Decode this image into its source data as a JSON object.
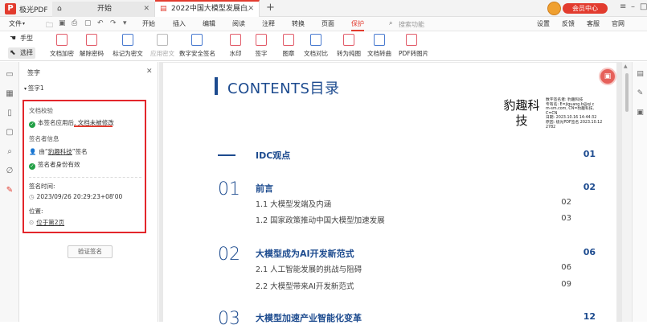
{
  "app": {
    "name": "极光PDF"
  },
  "tabs": [
    {
      "label": "开始"
    },
    {
      "label": "2022中国大模型发展白皮书..."
    }
  ],
  "vip": {
    "label": "会员中心"
  },
  "menu": [
    "文件",
    "开始",
    "插入",
    "编辑",
    "阅读",
    "注释",
    "转换",
    "页面",
    "保护",
    "设置",
    "反馈",
    "客服",
    "官网"
  ],
  "search": {
    "placeholder": "搜索功能"
  },
  "side_tools": [
    "手型",
    "选择"
  ],
  "toolbar": [
    "文档加密",
    "解除密码",
    "标记为密文",
    "应用密文",
    "数字安全签名",
    "水印",
    "签字",
    "图章",
    "文档对比",
    "转为纯图",
    "文档转曲",
    "PDF转图片"
  ],
  "panel": {
    "title": "签字",
    "signature_name": "签字1",
    "doc_check_label": "文档校验",
    "doc_check_prefix": "本签名应用后,",
    "doc_check_status": "文档未被修改",
    "signer_info_label": "签名者信息",
    "signer_prefix": "由“",
    "signer_name": "豹趣科技",
    "signer_suffix": "”签名",
    "signer_valid": "签名者身份有效",
    "time_label": "签名时间:",
    "time_value": "2023/09/26 20:29:23+08'00",
    "location_label": "位置:",
    "location_value": "位于第2页",
    "verify_button": "验证签名"
  },
  "document": {
    "title": "CONTENTS目录",
    "stamp_text": "豹趣科技",
    "stamp_details": "数字签名者: 豹趣科技\n专有名: E=jiguang.b@qi c\nm-sm.com, CN=豹趣科技,\nC=CN\n日期: 2023.10.16 14:44:32\n原因: 极光PDF签名 2023.10.12\n2782",
    "entries": [
      {
        "num": "",
        "title": "IDC观点",
        "page": "01",
        "subs": []
      },
      {
        "num": "01",
        "title": "前言",
        "page": "02",
        "subs": [
          {
            "title": "1.1 大模型发端及内涵",
            "page": "02"
          },
          {
            "title": "1.2 国家政策推动中国大模型加速发展",
            "page": "03"
          }
        ]
      },
      {
        "num": "02",
        "title": "大模型成为AI开发新范式",
        "page": "06",
        "subs": [
          {
            "title": "2.1 人工智能发展的挑战与阻碍",
            "page": "06"
          },
          {
            "title": "2.2 大模型带来AI开发新范式",
            "page": "09"
          }
        ]
      },
      {
        "num": "03",
        "title": "大模型加速产业智能化变革",
        "page": "12",
        "subs": []
      }
    ]
  },
  "colors": {
    "accent": "#e23b2e",
    "navy": "#1d4b8f",
    "highlight_box": "#e3262b",
    "check": "#22a046"
  }
}
